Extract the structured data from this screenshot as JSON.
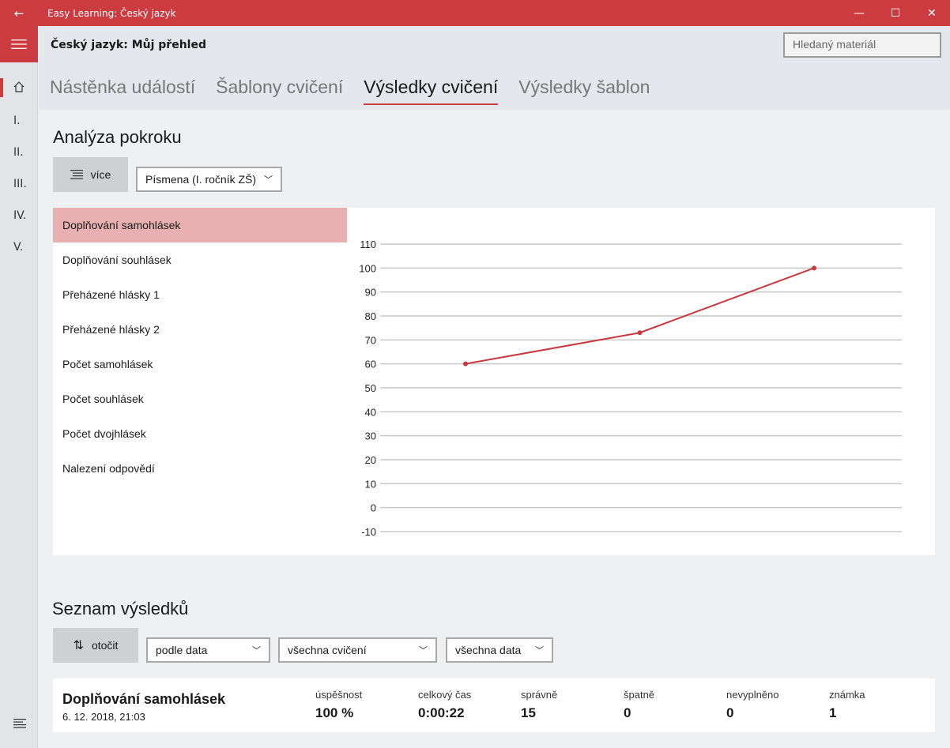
{
  "window": {
    "title": "Easy Learning: Český jazyk",
    "back_icon": "arrow-left-icon",
    "minimize": "—",
    "maximize": "☐",
    "close": "✕"
  },
  "rail": {
    "items": [
      "I.",
      "II.",
      "III.",
      "IV.",
      "V."
    ]
  },
  "header": {
    "title": "Český jazyk: Můj přehled",
    "search_placeholder": "Hledaný materiál",
    "tabs": [
      {
        "label": "Nástěnka událostí",
        "active": false
      },
      {
        "label": "Šablony cvičení",
        "active": false
      },
      {
        "label": "Výsledky cvičení",
        "active": true
      },
      {
        "label": "Výsledky šablon",
        "active": false
      }
    ]
  },
  "analysis": {
    "heading": "Analýza pokroku",
    "more_button": "více",
    "category_select": "Písmena (I. ročník ZŠ)",
    "exercises": [
      "Doplňování samohlásek",
      "Doplňování souhlásek",
      "Přeházené hlásky 1",
      "Přeházené hlásky 2",
      "Počet samohlásek",
      "Počet souhlásek",
      "Počet dvojhlásek",
      "Nalezení odpovědí"
    ],
    "selected_index": 0
  },
  "chart_data": {
    "type": "line",
    "title": "",
    "xlabel": "",
    "ylabel": "",
    "ylim": [
      -10,
      110
    ],
    "yticks": [
      110,
      100,
      90,
      80,
      70,
      60,
      50,
      40,
      30,
      20,
      10,
      0,
      -10
    ],
    "grid": true,
    "series": [
      {
        "values": [
          60,
          73,
          100
        ],
        "color": "#c9383d"
      }
    ]
  },
  "results": {
    "heading": "Seznam výsledků",
    "rotate_button": "otočit",
    "sort_select": "podle data",
    "exercise_select": "všechna cvičení",
    "date_select": "všechna data",
    "items": [
      {
        "title": "Doplňování samohlásek",
        "date": "6. 12. 2018, 21:03",
        "stats": [
          {
            "label": "úspěšnost",
            "value": "100 %"
          },
          {
            "label": "celkový čas",
            "value": "0:00:22"
          },
          {
            "label": "správně",
            "value": "15"
          },
          {
            "label": "špatně",
            "value": "0"
          },
          {
            "label": "nevyplněno",
            "value": "0"
          },
          {
            "label": "známka",
            "value": "1"
          }
        ]
      }
    ]
  },
  "colors": {
    "accent": "#cc3b40",
    "selected_row": "#e8b0b1"
  }
}
